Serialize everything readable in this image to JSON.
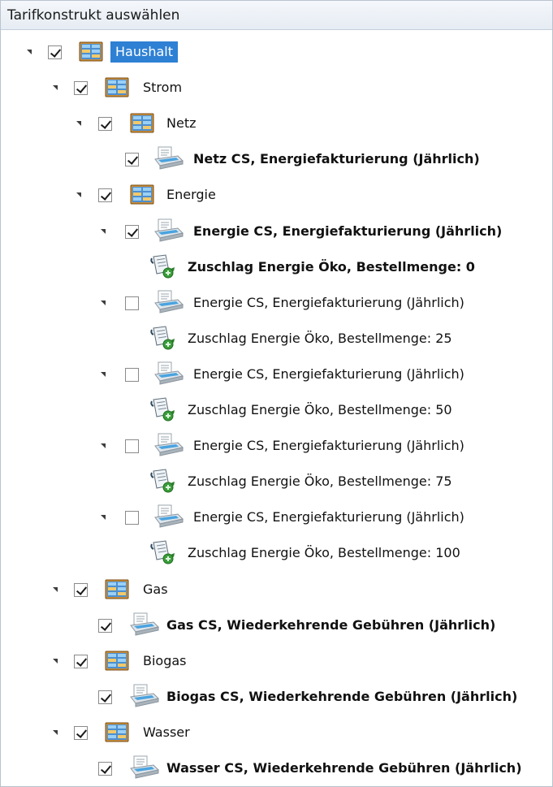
{
  "header": {
    "title": "Tarifkonstrukt auswählen"
  },
  "tree": [
    {
      "level": 0,
      "kind": "folder",
      "label": "Haushalt",
      "checked": true,
      "expanded": true,
      "bold": false,
      "selected": true,
      "icon": "folder-grid-icon"
    },
    {
      "level": 1,
      "kind": "folder",
      "label": "Strom",
      "checked": true,
      "expanded": true,
      "bold": false,
      "icon": "folder-grid-icon"
    },
    {
      "level": 2,
      "kind": "folder",
      "label": "Netz",
      "checked": true,
      "expanded": true,
      "bold": false,
      "icon": "folder-grid-icon"
    },
    {
      "level": 3,
      "kind": "rate",
      "label": "Netz CS, Energiefakturierung (Jährlich)",
      "checked": true,
      "bold": true,
      "icon": "rate-document-icon"
    },
    {
      "level": 2,
      "kind": "folder",
      "label": "Energie",
      "checked": true,
      "expanded": true,
      "bold": false,
      "icon": "folder-grid-icon"
    },
    {
      "level": 3,
      "kind": "rate",
      "label": "Energie CS, Energiefakturierung (Jährlich)",
      "checked": true,
      "expanded": true,
      "bold": true,
      "icon": "rate-document-icon"
    },
    {
      "level": 4,
      "kind": "surcharge",
      "label": "Zuschlag Energie Öko, Bestellmenge: 0",
      "bold": true,
      "icon": "surcharge-scroll-icon"
    },
    {
      "level": 3,
      "kind": "rate",
      "label": "Energie CS, Energiefakturierung (Jährlich)",
      "checked": false,
      "expanded": true,
      "bold": false,
      "icon": "rate-document-icon"
    },
    {
      "level": 4,
      "kind": "surcharge",
      "label": "Zuschlag Energie Öko, Bestellmenge: 25",
      "bold": false,
      "icon": "surcharge-scroll-icon"
    },
    {
      "level": 3,
      "kind": "rate",
      "label": "Energie CS, Energiefakturierung (Jährlich)",
      "checked": false,
      "expanded": true,
      "bold": false,
      "icon": "rate-document-icon"
    },
    {
      "level": 4,
      "kind": "surcharge",
      "label": "Zuschlag Energie Öko, Bestellmenge: 50",
      "bold": false,
      "icon": "surcharge-scroll-icon"
    },
    {
      "level": 3,
      "kind": "rate",
      "label": "Energie CS, Energiefakturierung (Jährlich)",
      "checked": false,
      "expanded": true,
      "bold": false,
      "icon": "rate-document-icon"
    },
    {
      "level": 4,
      "kind": "surcharge",
      "label": "Zuschlag Energie Öko, Bestellmenge: 75",
      "bold": false,
      "icon": "surcharge-scroll-icon"
    },
    {
      "level": 3,
      "kind": "rate",
      "label": "Energie CS, Energiefakturierung (Jährlich)",
      "checked": false,
      "expanded": true,
      "bold": false,
      "icon": "rate-document-icon"
    },
    {
      "level": 4,
      "kind": "surcharge",
      "label": "Zuschlag Energie Öko, Bestellmenge: 100",
      "bold": false,
      "icon": "surcharge-scroll-icon"
    },
    {
      "level": 1,
      "kind": "folder",
      "label": "Gas",
      "checked": true,
      "expanded": true,
      "bold": false,
      "icon": "folder-grid-icon"
    },
    {
      "level": 2,
      "kind": "rate",
      "label": "Gas CS, Wiederkehrende Gebühren (Jährlich)",
      "checked": true,
      "bold": true,
      "icon": "rate-document-icon"
    },
    {
      "level": 1,
      "kind": "folder",
      "label": "Biogas",
      "checked": true,
      "expanded": true,
      "bold": false,
      "icon": "folder-grid-icon"
    },
    {
      "level": 2,
      "kind": "rate",
      "label": "Biogas CS, Wiederkehrende Gebühren (Jährlich)",
      "checked": true,
      "bold": true,
      "icon": "rate-document-icon"
    },
    {
      "level": 1,
      "kind": "folder",
      "label": "Wasser",
      "checked": true,
      "expanded": true,
      "bold": false,
      "icon": "folder-grid-icon"
    },
    {
      "level": 2,
      "kind": "rate",
      "label": "Wasser CS, Wiederkehrende Gebühren (Jährlich)",
      "checked": true,
      "bold": true,
      "icon": "rate-document-icon"
    }
  ],
  "colors": {
    "selection": "#2e80d4",
    "border": "#b9c3cf",
    "header_bg": "#e9eef4"
  }
}
